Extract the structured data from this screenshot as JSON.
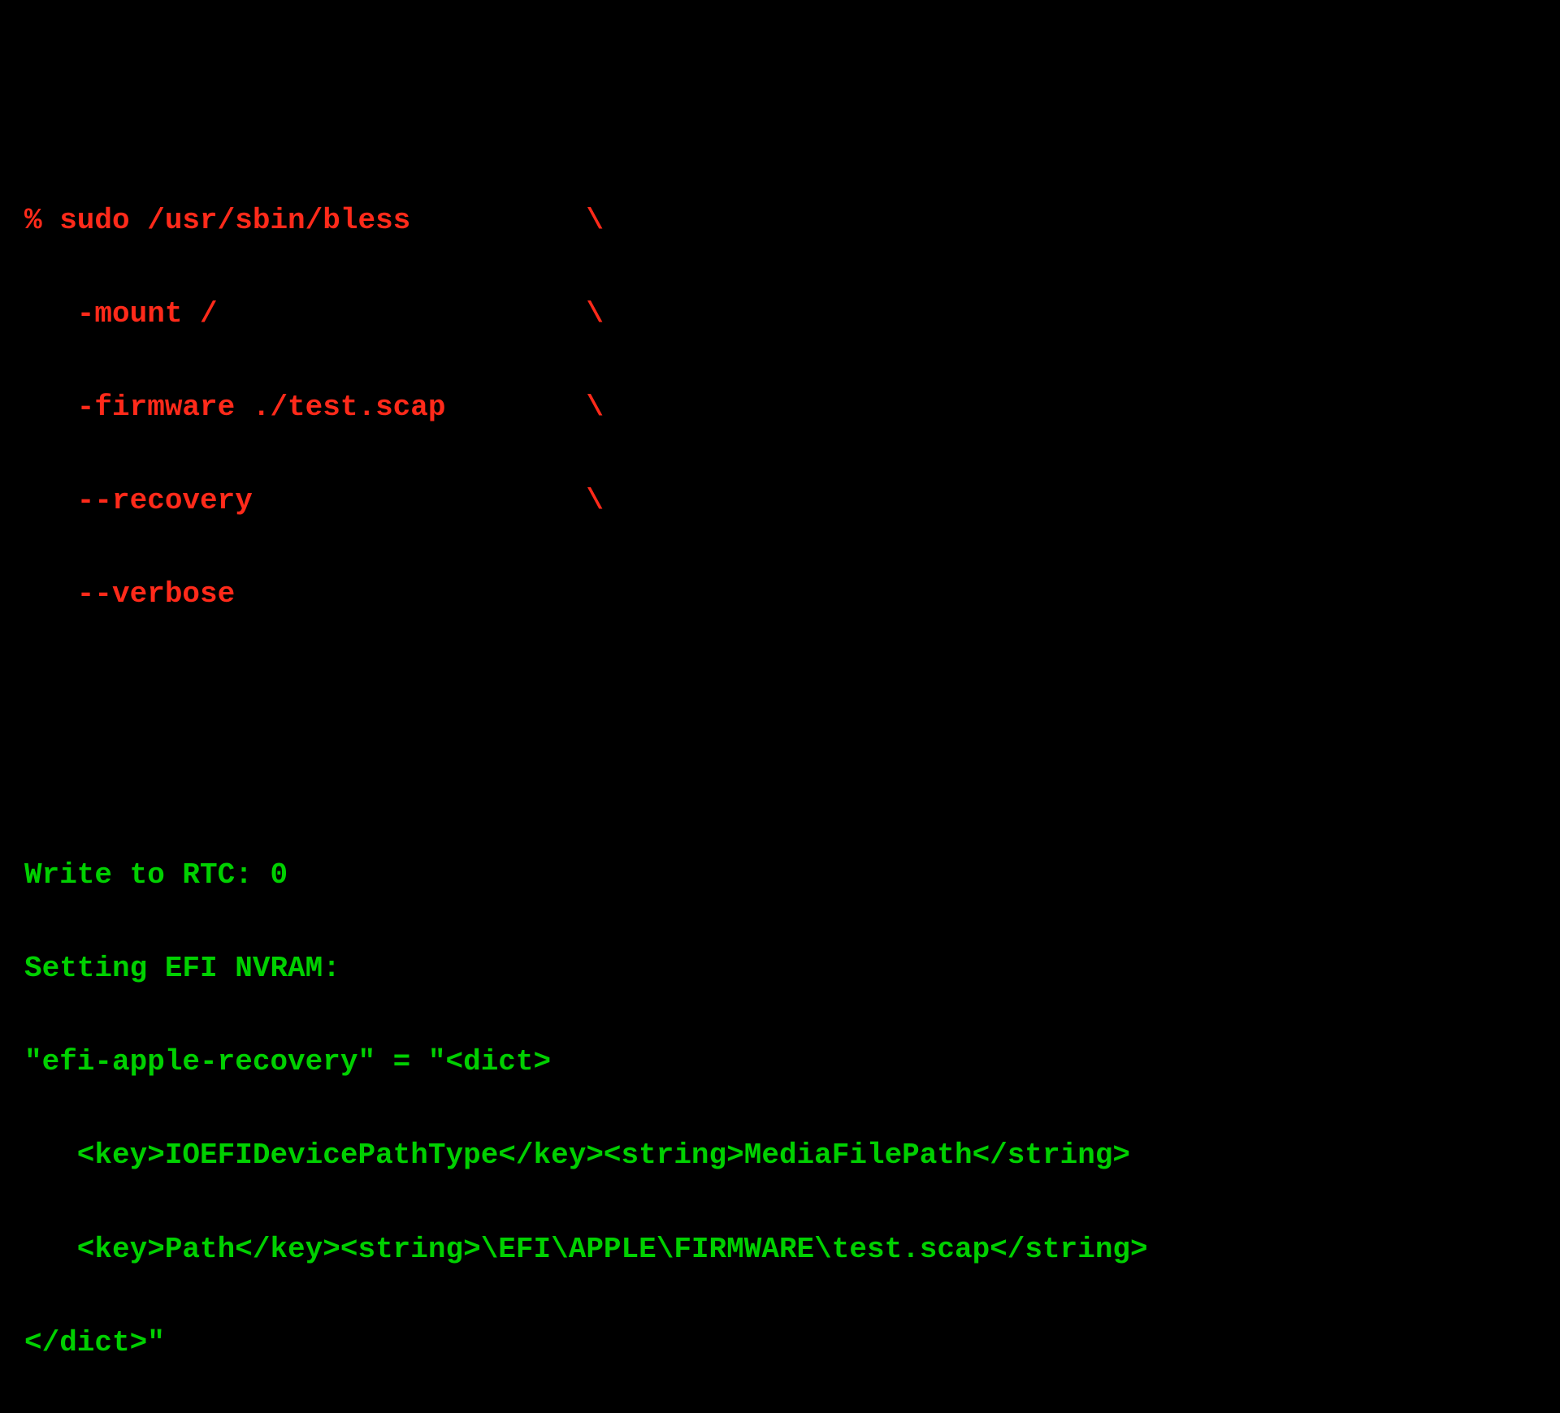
{
  "command": {
    "line1": "% sudo /usr/sbin/bless          \\",
    "line2": "   -mount /                     \\",
    "line3": "   -firmware ./test.scap        \\",
    "line4": "   --recovery                   \\",
    "line5": "   --verbose"
  },
  "output": {
    "line1": "Write to RTC: 0",
    "line2": "Setting EFI NVRAM:",
    "line3": "\"efi-apple-recovery\" = \"<dict>",
    "line4": "   <key>IOEFIDevicePathType</key><string>MediaFilePath</string>",
    "line5": "   <key>Path</key><string>\\EFI\\APPLE\\FIRMWARE\\test.scap</string>",
    "line6": "</dict>\""
  }
}
